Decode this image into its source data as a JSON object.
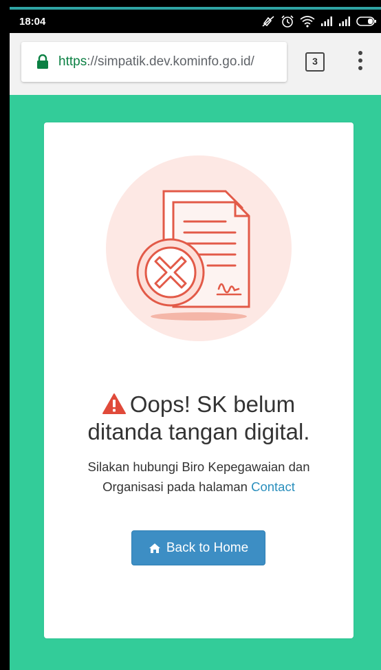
{
  "status_bar": {
    "time": "18:04",
    "icons": [
      "mute-icon",
      "alarm-icon",
      "wifi-icon",
      "signal-icon",
      "signal-icon",
      "battery-icon"
    ]
  },
  "browser": {
    "url_scheme": "https",
    "url_rest": "://simpatik.dev.kominfo.go.id/",
    "tab_count": "3"
  },
  "page": {
    "headline_line1": "Oops! SK belum",
    "headline_line2": "ditanda tangan digital.",
    "message": "Silakan hubungi Biro Kepegawaian dan Organisasi pada halaman",
    "contact_link": "Contact",
    "back_button_label": "Back to Home"
  },
  "colors": {
    "page_background": "#33cc99",
    "button": "#3d8ec4",
    "link": "#2a8fbd",
    "warning": "#e04a3a",
    "secure_url": "#0b8043"
  }
}
